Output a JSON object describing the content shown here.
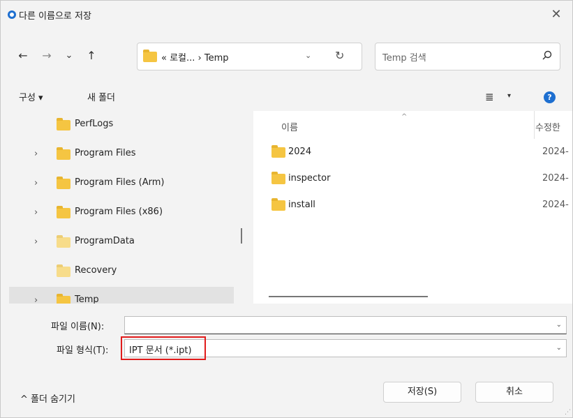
{
  "titlebar": {
    "title": "다른 이름으로 저장",
    "close": "✕"
  },
  "nav": {
    "back": "←",
    "forward": "→",
    "recent": "⌄",
    "up": "↑",
    "address": "« 로컬... › Temp",
    "address_dd": "⌄",
    "refresh": "↻",
    "search_placeholder": "Temp 검색"
  },
  "toolbar": {
    "organize": "구성 ▾",
    "new_folder": "새 폴더",
    "view": "≣",
    "view_dd": "▾",
    "help": "?"
  },
  "tree": [
    {
      "label": "PerfLogs",
      "chevron": ""
    },
    {
      "label": "Program Files",
      "chevron": "›"
    },
    {
      "label": "Program Files (Arm)",
      "chevron": "›"
    },
    {
      "label": "Program Files (x86)",
      "chevron": "›"
    },
    {
      "label": "ProgramData",
      "chevron": "›"
    },
    {
      "label": "Recovery",
      "chevron": ""
    },
    {
      "label": "Temp",
      "chevron": "›"
    }
  ],
  "files": {
    "col_name": "이름",
    "col_date": "수정한",
    "sort_indicator": "^",
    "rows": [
      {
        "name": "2024",
        "date": "2024-"
      },
      {
        "name": "inspector",
        "date": "2024-"
      },
      {
        "name": "install",
        "date": "2024-"
      }
    ]
  },
  "form": {
    "filename_label": "파일 이름(N):",
    "filename_value": "",
    "filetype_label": "파일 형식(T):",
    "filetype_value": "IPT 문서 (*.ipt)",
    "dd": "⌄"
  },
  "footer": {
    "hide_folders": "^  폴더 숨기기",
    "save": "저장(S)",
    "cancel": "취소"
  },
  "colors": {
    "accent": "#1e6fd0",
    "folder": "#f5c542",
    "highlight": "#e11b1b"
  }
}
